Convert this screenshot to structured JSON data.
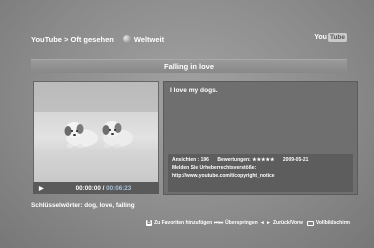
{
  "header": {
    "breadcrumb": "YouTube > Oft gesehen",
    "section": "Weltweit",
    "logo_you": "You",
    "logo_tube": "Tube",
    "section_icon": "globe-icon"
  },
  "video": {
    "title": "Falling in love",
    "current_time": "00:00:00",
    "separator": " / ",
    "total_time": "00:06:23",
    "play_icon": "play-icon",
    "keywords": "Schlüsselwörter: dog, love, falling"
  },
  "details": {
    "description": "I love my dogs.",
    "views_label": "Ansichten : 196",
    "rating_label": "Bewertungen: ★★★★★",
    "date": "2009-05-21",
    "copyright_label": "Melden Sie Urheberrechtsverstöße:",
    "copyright_url": "http://www.youtube.com/t/copyright_notice"
  },
  "footer": {
    "favorites_key": "B",
    "favorites_label": "Zu Favoriten hinzufügen",
    "skip_symbol": "⏮⏭",
    "skip_label": "Überspringen",
    "nav_symbol": "◄ ►",
    "back_label": "Zurück/Vorw",
    "fullscreen_label": "Vollbildschirm"
  },
  "colors": {
    "background": "#8c8c8c",
    "panel": "#6f6f6f",
    "time_total": "#a8c2dc"
  }
}
